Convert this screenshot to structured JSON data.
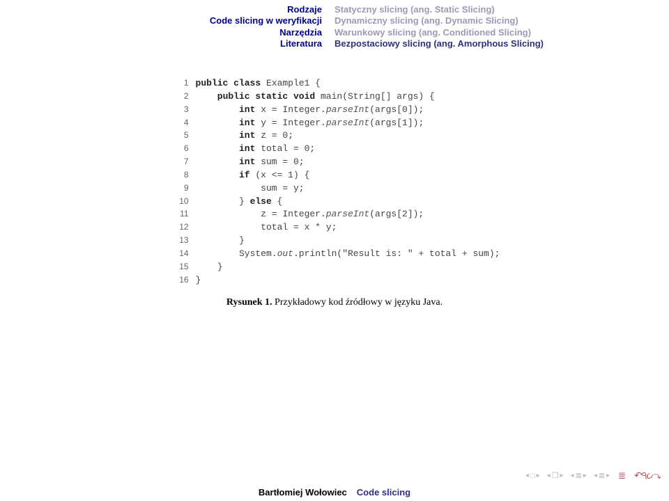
{
  "header": {
    "left": [
      "Rodzaje",
      "Code slicing w weryfikacji",
      "Narzędzia",
      "Literatura"
    ],
    "right": [
      {
        "text": "Statyczny slicing (ang. Static Slicing)",
        "active": false
      },
      {
        "text": "Dynamiczny slicing (ang. Dynamic Slicing)",
        "active": false
      },
      {
        "text": "Warunkowy slicing (ang. Conditioned Slicing)",
        "active": false
      },
      {
        "text": "Bezpostaciowy slicing (ang. Amorphous Slicing)",
        "active": true
      }
    ]
  },
  "code": {
    "lines": [
      {
        "n": "1",
        "indent": 0,
        "tokens": [
          {
            "t": "public class ",
            "c": "kw"
          },
          {
            "t": "Example1 {",
            "c": ""
          }
        ]
      },
      {
        "n": "2",
        "indent": 1,
        "tokens": [
          {
            "t": "public static void ",
            "c": "kw"
          },
          {
            "t": "main(String[] args) {",
            "c": ""
          }
        ]
      },
      {
        "n": "3",
        "indent": 2,
        "tokens": [
          {
            "t": "int ",
            "c": "kw"
          },
          {
            "t": "x = Integer.",
            "c": ""
          },
          {
            "t": "parseInt",
            "c": "it"
          },
          {
            "t": "(args[0]);",
            "c": ""
          }
        ]
      },
      {
        "n": "4",
        "indent": 2,
        "tokens": [
          {
            "t": "int ",
            "c": "kw"
          },
          {
            "t": "y = Integer.",
            "c": ""
          },
          {
            "t": "parseInt",
            "c": "it"
          },
          {
            "t": "(args[1]);",
            "c": ""
          }
        ]
      },
      {
        "n": "5",
        "indent": 2,
        "tokens": [
          {
            "t": "int ",
            "c": "kw"
          },
          {
            "t": "z = 0;",
            "c": ""
          }
        ]
      },
      {
        "n": "6",
        "indent": 2,
        "tokens": [
          {
            "t": "int ",
            "c": "kw"
          },
          {
            "t": "total = 0;",
            "c": ""
          }
        ]
      },
      {
        "n": "7",
        "indent": 2,
        "tokens": [
          {
            "t": "int ",
            "c": "kw"
          },
          {
            "t": "sum = 0;",
            "c": ""
          }
        ]
      },
      {
        "n": "8",
        "indent": 2,
        "tokens": [
          {
            "t": "if ",
            "c": "kw"
          },
          {
            "t": "(x <= 1) {",
            "c": ""
          }
        ]
      },
      {
        "n": "9",
        "indent": 3,
        "tokens": [
          {
            "t": "sum = y;",
            "c": ""
          }
        ]
      },
      {
        "n": "10",
        "indent": 2,
        "tokens": [
          {
            "t": "} ",
            "c": ""
          },
          {
            "t": "else ",
            "c": "kw"
          },
          {
            "t": "{",
            "c": ""
          }
        ]
      },
      {
        "n": "11",
        "indent": 3,
        "tokens": [
          {
            "t": "z = Integer.",
            "c": ""
          },
          {
            "t": "parseInt",
            "c": "it"
          },
          {
            "t": "(args[2]);",
            "c": ""
          }
        ]
      },
      {
        "n": "12",
        "indent": 3,
        "tokens": [
          {
            "t": "total = x * y;",
            "c": ""
          }
        ]
      },
      {
        "n": "13",
        "indent": 2,
        "tokens": [
          {
            "t": "}",
            "c": ""
          }
        ]
      },
      {
        "n": "14",
        "indent": 2,
        "tokens": [
          {
            "t": "System.",
            "c": ""
          },
          {
            "t": "out",
            "c": "it"
          },
          {
            "t": ".println(",
            "c": ""
          },
          {
            "t": "\"Result is: \"",
            "c": ""
          },
          {
            "t": " + total + sum);",
            "c": ""
          }
        ]
      },
      {
        "n": "15",
        "indent": 1,
        "tokens": [
          {
            "t": "}",
            "c": ""
          }
        ]
      },
      {
        "n": "16",
        "indent": 0,
        "tokens": [
          {
            "t": "}",
            "c": ""
          }
        ]
      }
    ]
  },
  "caption": {
    "label": "Rysunek 1.",
    "text": " Przykładowy kod źródłowy w języku Java."
  },
  "footer": {
    "author": "Bartłomiej Wołowiec",
    "title": "Code slicing"
  },
  "nav": {
    "groups": [
      "slide",
      "section",
      "subsection",
      "appendix"
    ],
    "extra": [
      "mode",
      "undo",
      "search",
      "redo"
    ]
  }
}
